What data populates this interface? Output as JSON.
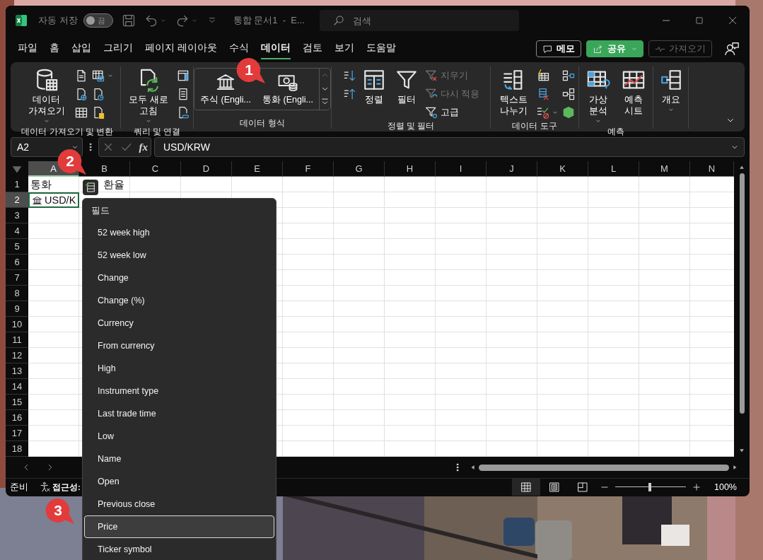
{
  "title_bar": {
    "autosave": {
      "label": "자동 저장",
      "on": false,
      "state_text": "끔"
    },
    "title": "통합 문서1  -  E...",
    "search": {
      "placeholder": "검색"
    }
  },
  "tabs": [
    {
      "label": "파일",
      "selected": false
    },
    {
      "label": "홈",
      "selected": false
    },
    {
      "label": "삽입",
      "selected": false
    },
    {
      "label": "그리기",
      "selected": false
    },
    {
      "label": "페이지 레이아웃",
      "selected": false
    },
    {
      "label": "수식",
      "selected": false
    },
    {
      "label": "데이터",
      "selected": true
    },
    {
      "label": "검토",
      "selected": false
    },
    {
      "label": "보기",
      "selected": false
    },
    {
      "label": "도움말",
      "selected": false
    }
  ],
  "header_buttons": [
    {
      "kind": "comments",
      "label": "메모",
      "disabled": false
    },
    {
      "kind": "share",
      "label": "공유",
      "disabled": false
    },
    {
      "kind": "catch_up",
      "label": "가져오기",
      "disabled": true
    }
  ],
  "ribbon": {
    "groups": [
      {
        "label": "데이터 가져오기 및 변환",
        "commands": [
          {
            "kind": "large",
            "label": "데이터 가져오기",
            "menu": true
          },
          {
            "kind": "stack",
            "items": [
              {
                "kind": "icon",
                "menu": false
              },
              {
                "kind": "icon",
                "menu": false
              },
              {
                "kind": "icon",
                "menu": false
              }
            ]
          },
          {
            "kind": "stack",
            "items": [
              {
                "kind": "icon",
                "menu": true
              },
              {
                "kind": "icon",
                "menu": false
              },
              {
                "kind": "icon",
                "menu": false
              }
            ]
          }
        ]
      },
      {
        "label": "쿼리 및 연결",
        "commands": [
          {
            "kind": "large",
            "label": "모두 새로 고침",
            "menu": true
          },
          {
            "kind": "stack",
            "items": [
              {
                "kind": "icon",
                "menu": false
              },
              {
                "kind": "icon",
                "menu": false
              },
              {
                "kind": "icon",
                "menu": false
              }
            ]
          }
        ]
      },
      {
        "label": "데이터 형식",
        "commands": [
          {
            "kind": "gallery",
            "items": [
              {
                "label": "주식 (Engli..."
              },
              {
                "label": "통화 (Engli..."
              }
            ]
          }
        ]
      },
      {
        "label": "정렬 및 필터",
        "commands": [
          {
            "kind": "stack",
            "items": [
              {
                "kind": "icon",
                "menu": false
              },
              {
                "kind": "icon",
                "menu": false
              }
            ]
          },
          {
            "kind": "large",
            "label": "정렬",
            "menu": false
          },
          {
            "kind": "large",
            "label": "필터",
            "menu": false
          },
          {
            "kind": "stack",
            "items": [
              {
                "kind": "small",
                "label": "지우기",
                "disabled": true
              },
              {
                "kind": "small",
                "label": "다시 적용",
                "disabled": true
              },
              {
                "kind": "small",
                "label": "고급",
                "disabled": false
              }
            ]
          }
        ]
      },
      {
        "label": "데이터 도구",
        "commands": [
          {
            "kind": "large",
            "label": "텍스트 나누기",
            "menu": false
          },
          {
            "kind": "stack",
            "items": [
              {
                "kind": "icon",
                "menu": false
              },
              {
                "kind": "icon",
                "menu": false
              },
              {
                "kind": "icon",
                "menu": true
              }
            ]
          },
          {
            "kind": "stack",
            "items": [
              {
                "kind": "icon",
                "menu": false
              },
              {
                "kind": "icon",
                "menu": false
              },
              {
                "kind": "icon",
                "menu": false
              }
            ]
          }
        ]
      },
      {
        "label": "예측",
        "commands": [
          {
            "kind": "large",
            "label": "가상 분석",
            "menu": true
          },
          {
            "kind": "large",
            "label": "예측 시트",
            "menu": false
          }
        ]
      },
      {
        "commands": [
          {
            "kind": "large",
            "label": "개요",
            "menu": true
          }
        ]
      }
    ]
  },
  "formula_bar": {
    "name_box": "A2",
    "function_label": "fx",
    "formula": "USD/KRW"
  },
  "sheet": {
    "columns": [
      {
        "label": "A",
        "selected": true
      },
      {
        "label": "B",
        "selected": false
      },
      {
        "label": "C",
        "selected": false
      },
      {
        "label": "D",
        "selected": false
      },
      {
        "label": "E",
        "selected": false
      },
      {
        "label": "F",
        "selected": false
      },
      {
        "label": "G",
        "selected": false
      },
      {
        "label": "H",
        "selected": false
      },
      {
        "label": "I",
        "selected": false
      },
      {
        "label": "J",
        "selected": false
      },
      {
        "label": "K",
        "selected": false
      },
      {
        "label": "L",
        "selected": false
      },
      {
        "label": "M",
        "selected": false
      },
      {
        "label": "N",
        "selected": false
      }
    ],
    "rows": [
      {
        "header": "1",
        "selected": false,
        "cells": [
          {
            "text": "통화",
            "linked": false,
            "selected": false
          },
          {
            "text": "환율",
            "linked": false,
            "selected": false
          }
        ]
      },
      {
        "header": "2",
        "selected": true,
        "cells": [
          {
            "text": "USD/K",
            "linked": true,
            "selected": true
          }
        ]
      },
      {
        "header": "3",
        "selected": false
      },
      {
        "header": "4",
        "selected": false
      },
      {
        "header": "5",
        "selected": false
      },
      {
        "header": "6",
        "selected": false
      },
      {
        "header": "7",
        "selected": false
      },
      {
        "header": "8",
        "selected": false
      },
      {
        "header": "9",
        "selected": false
      },
      {
        "header": "10",
        "selected": false
      },
      {
        "header": "11",
        "selected": false
      },
      {
        "header": "12",
        "selected": false
      },
      {
        "header": "13",
        "selected": false
      },
      {
        "header": "14",
        "selected": false
      },
      {
        "header": "15",
        "selected": false
      },
      {
        "header": "16",
        "selected": false
      },
      {
        "header": "17",
        "selected": false
      },
      {
        "header": "18",
        "selected": false
      }
    ]
  },
  "status_bar": {
    "mode": "준비",
    "accessibility": "접근성:",
    "views": [
      {
        "selected": true
      },
      {
        "selected": false
      },
      {
        "selected": false
      }
    ],
    "zoom": {
      "level": 0.49,
      "label": "100%"
    }
  },
  "field_menu": {
    "title": "필드",
    "items": [
      {
        "label": "52 week high",
        "selected": false
      },
      {
        "label": "52 week low",
        "selected": false
      },
      {
        "label": "Change",
        "selected": false
      },
      {
        "label": "Change (%)",
        "selected": false
      },
      {
        "label": "Currency",
        "selected": false
      },
      {
        "label": "From currency",
        "selected": false
      },
      {
        "label": "High",
        "selected": false
      },
      {
        "label": "Instrument type",
        "selected": false
      },
      {
        "label": "Last trade time",
        "selected": false
      },
      {
        "label": "Low",
        "selected": false
      },
      {
        "label": "Name",
        "selected": false
      },
      {
        "label": "Open",
        "selected": false
      },
      {
        "label": "Previous close",
        "selected": false
      },
      {
        "label": "Price",
        "selected": true
      },
      {
        "label": "Ticker symbol",
        "selected": false
      }
    ]
  },
  "callouts": [
    {
      "label": "1"
    },
    {
      "label": "2"
    },
    {
      "label": "3"
    }
  ]
}
